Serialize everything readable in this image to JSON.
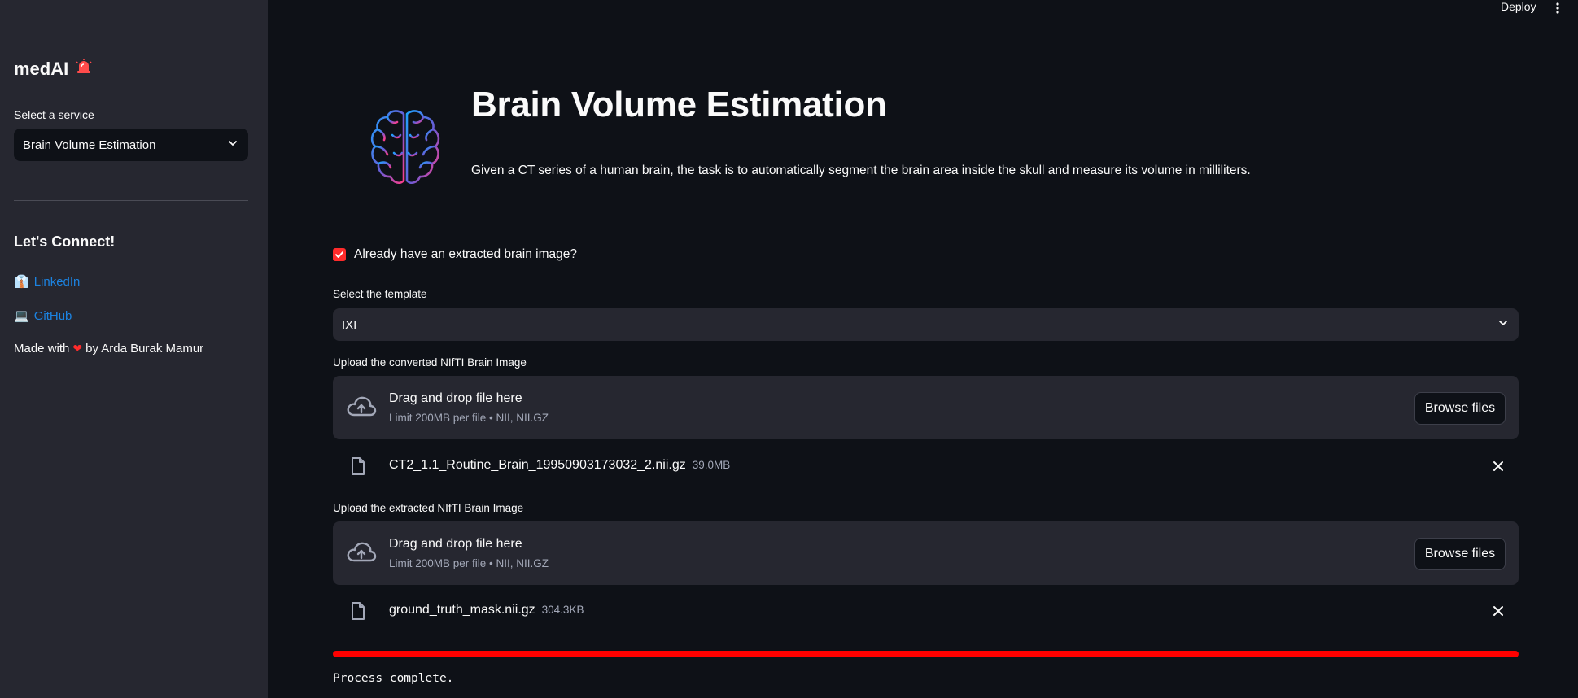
{
  "header": {
    "deploy_label": "Deploy",
    "menu_icon": "kebab-menu-icon"
  },
  "sidebar": {
    "title": "medAI",
    "title_icon": "siren-icon",
    "service_label": "Select a service",
    "service_value": "Brain Volume Estimation",
    "connect_heading": "Let's Connect!",
    "links": [
      {
        "icon": "briefcase-icon",
        "glyph": "👔",
        "label": "LinkedIn"
      },
      {
        "icon": "laptop-icon",
        "glyph": "💻",
        "label": "GitHub"
      }
    ],
    "made_with_prefix": "Made with",
    "made_with_suffix": "by Arda Burak Mamur"
  },
  "main": {
    "title": "Brain Volume Estimation",
    "description": "Given a CT series of a human brain, the task is to automatically segment the brain area inside the skull and measure its volume in milliliters.",
    "checkbox_label": "Already have an extracted brain image?",
    "checkbox_checked": true,
    "template_label": "Select the template",
    "template_value": "IXI",
    "uploaders": [
      {
        "label": "Upload the converted NIfTI Brain Image",
        "drop_title": "Drag and drop file here",
        "drop_limit": "Limit 200MB per file • NII, NII.GZ",
        "browse_label": "Browse files",
        "file_name": "CT2_1.1_Routine_Brain_19950903173032_2.nii.gz",
        "file_size": "39.0MB"
      },
      {
        "label": "Upload the extracted NIfTI Brain Image",
        "drop_title": "Drag and drop file here",
        "drop_limit": "Limit 200MB per file • NII, NII.GZ",
        "browse_label": "Browse files",
        "file_name": "ground_truth_mask.nii.gz",
        "file_size": "304.3KB"
      }
    ],
    "progress_fraction": 1.0,
    "status_text": "Process complete."
  },
  "colors": {
    "background": "#0e1117",
    "sidebar": "#262730",
    "accent": "#ff2b2b",
    "link": "#1c83e1",
    "muted_text": "#a3a8b8"
  }
}
